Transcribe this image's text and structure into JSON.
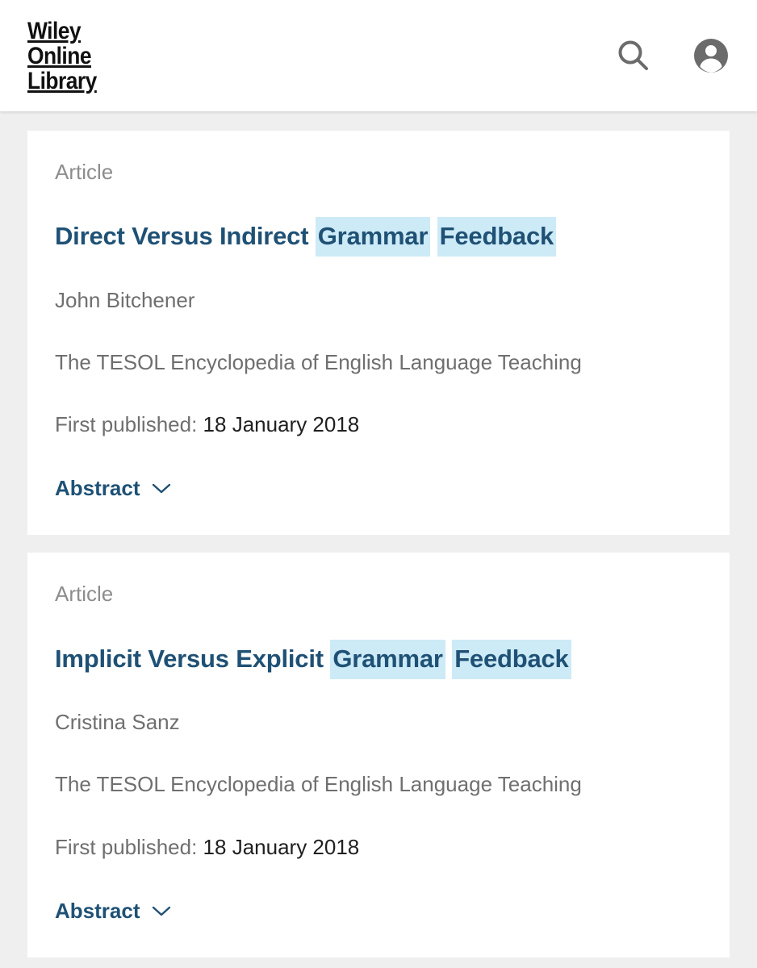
{
  "header": {
    "logo_lines": [
      "Wiley",
      "Online",
      "Library"
    ],
    "logo_alt": "Wiley Online Library",
    "search_icon": "search-icon",
    "account_icon": "account-icon"
  },
  "colors": {
    "page_background": "#efeff0",
    "card_background": "#ffffff",
    "title_link": "#1f5175",
    "muted_text": "#6f6f6f",
    "label_text": "#8d8d8d",
    "highlight_background": "#cdeaf7",
    "icon_gray": "#6b6b6b",
    "date_text": "#202020"
  },
  "results": [
    {
      "content_type": "Article",
      "title_parts": [
        {
          "text": "Direct Versus Indirect ",
          "highlight": false
        },
        {
          "text": "Grammar",
          "highlight": true
        },
        {
          "text": " ",
          "highlight": false
        },
        {
          "text": "Feedback",
          "highlight": true
        }
      ],
      "title_plain": "Direct Versus Indirect Grammar Feedback",
      "authors": "John Bitchener",
      "source": "The TESOL Encyclopedia of English Language Teaching",
      "published_label": "First published:",
      "published_date": "18 January 2018",
      "abstract_label": "Abstract"
    },
    {
      "content_type": "Article",
      "title_parts": [
        {
          "text": "Implicit Versus Explicit ",
          "highlight": false
        },
        {
          "text": "Grammar",
          "highlight": true
        },
        {
          "text": " ",
          "highlight": false
        },
        {
          "text": "Feedback",
          "highlight": true
        }
      ],
      "title_plain": "Implicit Versus Explicit Grammar Feedback",
      "authors": "Cristina Sanz",
      "source": "The TESOL Encyclopedia of English Language Teaching",
      "published_label": "First published:",
      "published_date": "18 January 2018",
      "abstract_label": "Abstract"
    }
  ]
}
